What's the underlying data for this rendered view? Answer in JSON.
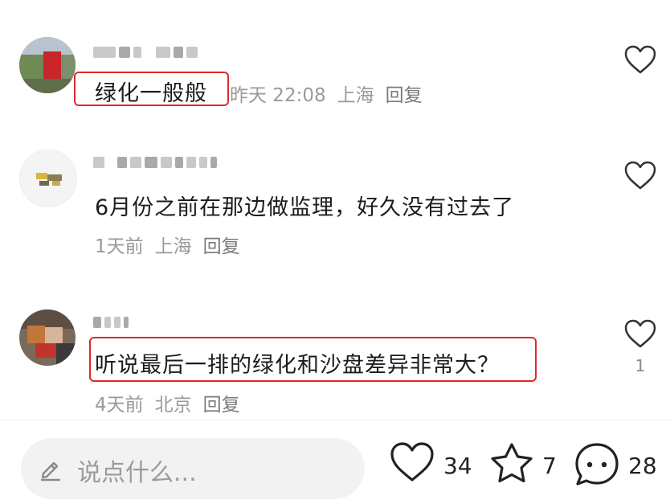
{
  "comments": [
    {
      "text": "绿化一般般",
      "meta_time": "昨天 22:08",
      "meta_location": "上海",
      "reply_label": "回复",
      "like_count": ""
    },
    {
      "text": "6月份之前在那边做监理，好久没有过去了",
      "meta_time": "1天前",
      "meta_location": "上海",
      "reply_label": "回复",
      "like_count": ""
    },
    {
      "text": "听说最后一排的绿化和沙盘差异非常大？",
      "meta_time": "4天前",
      "meta_location": "北京",
      "reply_label": "回复",
      "like_count": "1"
    }
  ],
  "bottom_bar": {
    "input_placeholder": "说点什么...",
    "likes": "34",
    "favorites": "7",
    "comments": "28"
  },
  "colors": {
    "highlight_border": "#e02a2a",
    "meta_gray": "#9a9a9a",
    "input_bg": "#f2f2f2"
  },
  "icons": [
    "heart-outline-icon",
    "star-outline-icon",
    "comment-bubble-icon",
    "pencil-icon"
  ]
}
